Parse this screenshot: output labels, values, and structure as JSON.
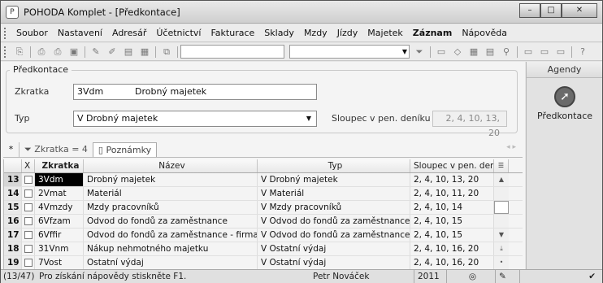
{
  "window": {
    "title": "POHODA Komplet - [Předkontace]",
    "minimize": "–",
    "maximize": "□",
    "close": "✕"
  },
  "menu": [
    "Soubor",
    "Nastavení",
    "Adresář",
    "Účetnictví",
    "Fakturace",
    "Sklady",
    "Mzdy",
    "Jízdy",
    "Majetek",
    "Záznam",
    "Nápověda"
  ],
  "form": {
    "legend": "Předkontace",
    "zkratka_label": "Zkratka",
    "zkratka_value": "3Vdm",
    "nazev_value": "Drobný majetek",
    "typ_label": "Typ",
    "typ_value": "V Drobný majetek",
    "sloupec_label": "Sloupec v pen. deníku",
    "sloupec_value": "2, 4, 10, 13, 20"
  },
  "tabs": {
    "star": "*",
    "filter": "Zkratka = 4",
    "notes": "Poznámky"
  },
  "table": {
    "headers": {
      "x": "X",
      "zkratka": "Zkratka",
      "nazev": "Název",
      "typ": "Typ",
      "sloupec": "Sloupec v pen. deníku"
    },
    "rows": [
      {
        "num": "13",
        "zkratka": "3Vdm",
        "nazev": "Drobný majetek",
        "typ": "V Drobný majetek",
        "sloupec": "2, 4, 10, 13, 20",
        "selected": true
      },
      {
        "num": "14",
        "zkratka": "2Vmat",
        "nazev": "Materiál",
        "typ": "V Materiál",
        "sloupec": "2, 4, 10, 11, 20"
      },
      {
        "num": "15",
        "zkratka": "4Vmzdy",
        "nazev": "Mzdy pracovníků",
        "typ": "V Mzdy pracovníků",
        "sloupec": "2, 4, 10, 14"
      },
      {
        "num": "16",
        "zkratka": "6Vfzam",
        "nazev": "Odvod do fondů za zaměstnance",
        "typ": "V Odvod do fondů za zaměstnance",
        "sloupec": "2, 4, 10, 15"
      },
      {
        "num": "17",
        "zkratka": "6Vffir",
        "nazev": "Odvod do fondů za zaměstnance - firma",
        "typ": "V Odvod do fondů za zaměstnance - firm",
        "sloupec": "2, 4, 10, 15"
      },
      {
        "num": "18",
        "zkratka": "31Vnm",
        "nazev": "Nákup nehmotného majetku",
        "typ": "V Ostatní výdaj",
        "sloupec": "2, 4, 10, 16, 20"
      },
      {
        "num": "19",
        "zkratka": "7Vost",
        "nazev": "Ostatní výdaj",
        "typ": "V Ostatní výdaj",
        "sloupec": "2, 4, 10, 16, 20"
      }
    ]
  },
  "sidebar": {
    "title": "Agendy",
    "item": "Předkontace"
  },
  "status": {
    "record": "(13/47)",
    "hint": "Pro získání nápovědy stiskněte F1.",
    "user": "Petr Nováček",
    "year": "2011"
  }
}
